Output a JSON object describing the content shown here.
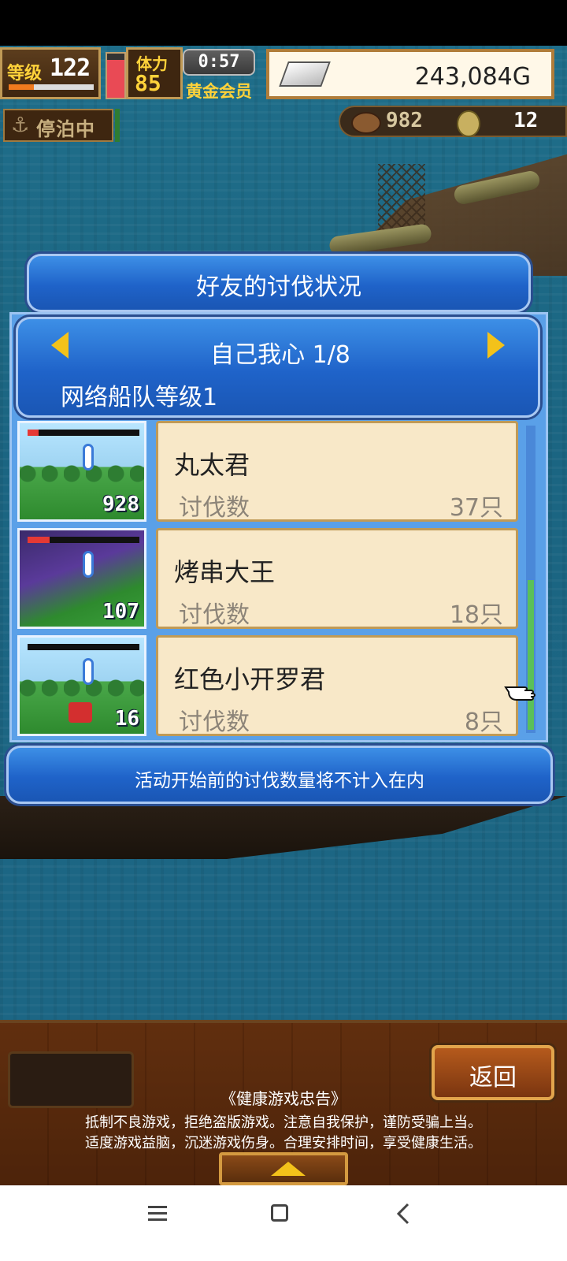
{
  "hud": {
    "level_label": "等级",
    "level_value": "122",
    "level_progress": 0.3,
    "stamina_fraction": 0.85,
    "stamina_label": "体力",
    "stamina_value": "85",
    "timer": "0:57",
    "membership": "黄金会员",
    "gold": "243,084G",
    "gold_icon": "silver-bar-icon",
    "anchor_icon": "anchor-icon",
    "anchor_status": "停泊中",
    "food_icon": "food-icon",
    "food_value": "982",
    "coin_icon": "coin-icon",
    "coin_value": "12"
  },
  "dialog": {
    "title": "好友的讨伐状况",
    "friend_name": "自己我心 1/8",
    "fleet_level": "网络船队等级1",
    "prev_icon": "arrow-left-icon",
    "next_icon": "arrow-right-icon",
    "kill_label": "讨伐数",
    "rows": [
      {
        "name": "丸太君",
        "kills": "37只",
        "thumb_number": "928",
        "hp": 0.1
      },
      {
        "name": "烤串大王",
        "kills": "18只",
        "thumb_number": "107",
        "hp": 0.2
      },
      {
        "name": "红色小开罗君",
        "kills": "8只",
        "thumb_number": "16",
        "hp": 0.0
      }
    ],
    "notice": "活动开始前的讨伐数量将不计入在内"
  },
  "bottom": {
    "back_label": "返回",
    "health_title": "《健康游戏忠告》",
    "health_line1": "抵制不良游戏，拒绝盗版游戏。注意自我保护，谨防受骗上当。",
    "health_line2": "适度游戏益脑，沉迷游戏伤身。合理安排时间，享受健康生活。"
  },
  "colors": {
    "panel_blue": "#1f63c9",
    "card_bg": "#f8e8c8",
    "gold_accent": "#f3c21a"
  }
}
